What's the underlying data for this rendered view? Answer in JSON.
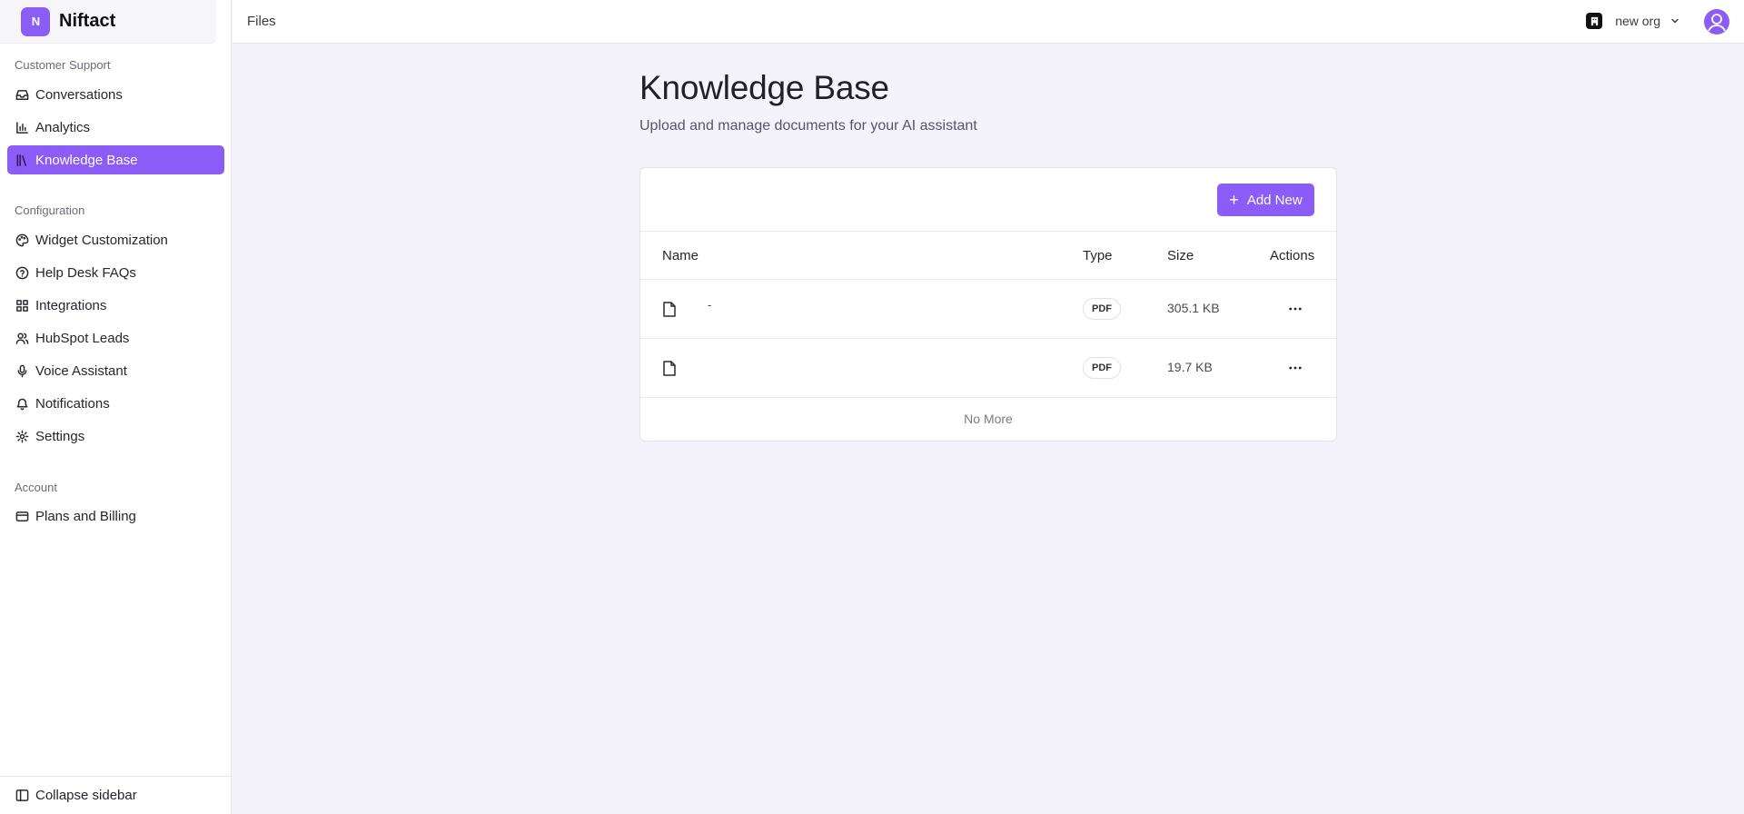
{
  "brand": {
    "logo_text": "N",
    "name": "Niftact"
  },
  "sidebar": {
    "sections": [
      {
        "label": "Customer Support"
      },
      {
        "label": "Configuration"
      },
      {
        "label": "Account"
      }
    ],
    "items": [
      {
        "label": "Conversations",
        "icon": "inbox-icon"
      },
      {
        "label": "Analytics",
        "icon": "bar-chart-icon"
      },
      {
        "label": "Knowledge Base",
        "icon": "library-icon",
        "active": true
      },
      {
        "label": "Widget Customization",
        "icon": "palette-icon"
      },
      {
        "label": "Help Desk FAQs",
        "icon": "help-circle-icon"
      },
      {
        "label": "Integrations",
        "icon": "grid-icon"
      },
      {
        "label": "HubSpot Leads",
        "icon": "users-icon"
      },
      {
        "label": "Voice Assistant",
        "icon": "mic-icon"
      },
      {
        "label": "Notifications",
        "icon": "bell-icon"
      },
      {
        "label": "Settings",
        "icon": "gear-icon"
      },
      {
        "label": "Plans and Billing",
        "icon": "credit-card-icon"
      }
    ],
    "collapse_label": "Collapse sidebar"
  },
  "topbar": {
    "breadcrumb": "Files",
    "org_name": "new org"
  },
  "page": {
    "title": "Knowledge Base",
    "subtitle": "Upload and manage documents for your AI assistant",
    "add_button": "Add New"
  },
  "table": {
    "headers": {
      "name": "Name",
      "type": "Type",
      "size": "Size",
      "actions": "Actions"
    },
    "rows": [
      {
        "name": "-",
        "type": "PDF",
        "size": "305.1 KB"
      },
      {
        "name": "",
        "type": "PDF",
        "size": "19.7 KB"
      }
    ],
    "footer": "No More"
  },
  "colors": {
    "accent": "#8b5cf6",
    "background": "#f4f3fb"
  }
}
